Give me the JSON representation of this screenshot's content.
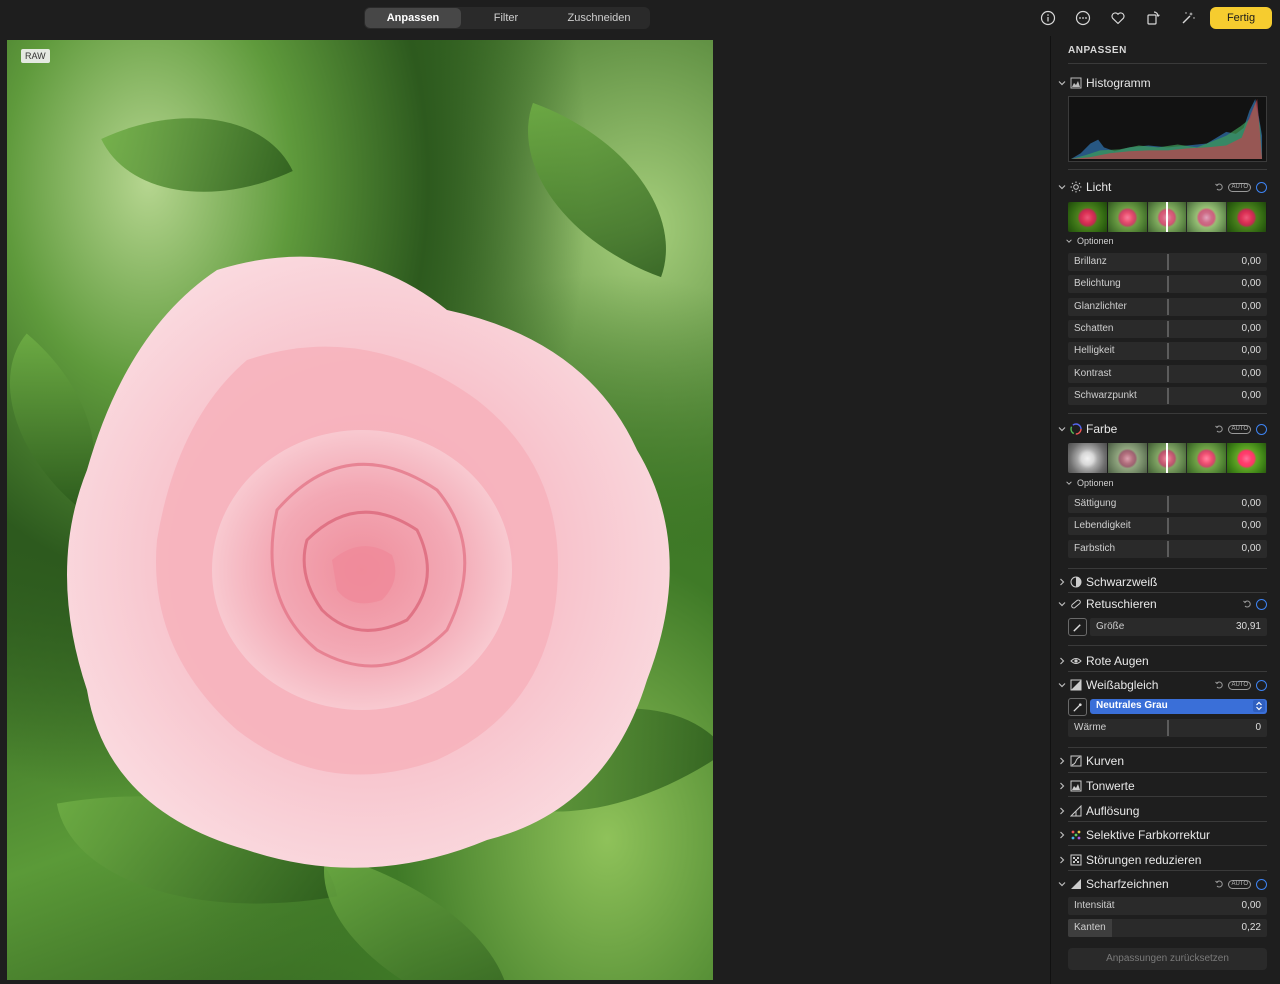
{
  "toolbar": {
    "tabs": [
      {
        "label": "Anpassen",
        "active": true
      },
      {
        "label": "Filter",
        "active": false
      },
      {
        "label": "Zuschneiden",
        "active": false
      }
    ],
    "icons": [
      "info-icon",
      "more-icon",
      "heart-icon",
      "rotate-icon",
      "magic-wand-icon"
    ],
    "done_label": "Fertig",
    "done_color": "#f6cc2f"
  },
  "photo": {
    "badge": "RAW"
  },
  "panel": {
    "title": "ANPASSEN",
    "histogram": {
      "label": "Histogramm"
    },
    "licht": {
      "label": "Licht",
      "auto": "AUTO",
      "options_label": "Optionen",
      "sliders": [
        {
          "label": "Brillanz",
          "value": "0,00"
        },
        {
          "label": "Belichtung",
          "value": "0,00"
        },
        {
          "label": "Glanzlichter",
          "value": "0,00"
        },
        {
          "label": "Schatten",
          "value": "0,00"
        },
        {
          "label": "Helligkeit",
          "value": "0,00"
        },
        {
          "label": "Kontrast",
          "value": "0,00"
        },
        {
          "label": "Schwarzpunkt",
          "value": "0,00"
        }
      ]
    },
    "farbe": {
      "label": "Farbe",
      "auto": "AUTO",
      "options_label": "Optionen",
      "sliders": [
        {
          "label": "Sättigung",
          "value": "0,00"
        },
        {
          "label": "Lebendigkeit",
          "value": "0,00"
        },
        {
          "label": "Farbstich",
          "value": "0,00"
        }
      ]
    },
    "schwarzweiss": {
      "label": "Schwarzweiß"
    },
    "retuschieren": {
      "label": "Retuschieren",
      "size_label": "Größe",
      "size_value": "30,91"
    },
    "rote_augen": {
      "label": "Rote Augen"
    },
    "weissabgleich": {
      "label": "Weißabgleich",
      "auto": "AUTO",
      "mode": "Neutrales Grau",
      "warmth_label": "Wärme",
      "warmth_value": "0"
    },
    "kurven": {
      "label": "Kurven"
    },
    "tonwerte": {
      "label": "Tonwerte"
    },
    "aufloesung": {
      "label": "Auflösung"
    },
    "selektive": {
      "label": "Selektive Farbkorrektur"
    },
    "stoerungen": {
      "label": "Störungen reduzieren"
    },
    "scharfzeichnen": {
      "label": "Scharfzeichnen",
      "auto": "AUTO",
      "sliders": [
        {
          "label": "Intensität",
          "value": "0,00",
          "fill": 0
        },
        {
          "label": "Kanten",
          "value": "0,22",
          "fill": 0.22
        }
      ]
    },
    "reset_label": "Anpassungen zurücksetzen",
    "accent_color": "#3d83f2"
  }
}
